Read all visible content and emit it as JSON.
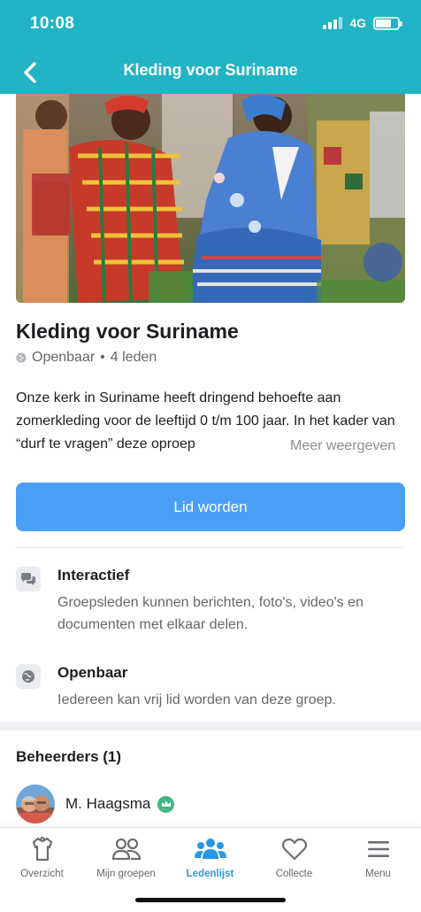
{
  "status_bar": {
    "time": "10:08",
    "network": "4G"
  },
  "nav": {
    "title": "Kleding voor Suriname",
    "back_icon": "chevron-left-icon"
  },
  "colors": {
    "header": "#22b3c4",
    "primary_button": "#4a9ff5",
    "active_tab": "#2a97e4",
    "admin_badge": "#42b883"
  },
  "group": {
    "name": "Kleding voor Suriname",
    "visibility": "Openbaar",
    "separator": "•",
    "members": "4 leden",
    "description": "Onze kerk in Suriname heeft dringend behoefte aan zomerkleding voor de leeftijd 0 t/m 100 jaar. In het kader van “durf te vragen” deze oproep",
    "more_label": "Meer weergeven",
    "join_label": "Lid worden"
  },
  "info": [
    {
      "title": "Interactief",
      "text": "Groepsleden kunnen berichten, foto's, video's en documenten met elkaar delen.",
      "icon": "chat-bubbles-icon"
    },
    {
      "title": "Openbaar",
      "text": "Iedereen kan vrij lid worden van deze groep.",
      "icon": "globe-icon"
    }
  ],
  "admins": {
    "heading": "Beheerders (1)",
    "list": [
      {
        "name": "M. Haagsma",
        "badge_icon": "crown-icon"
      }
    ]
  },
  "tabs": [
    {
      "label": "Overzicht",
      "icon": "shirt-icon",
      "active": false
    },
    {
      "label": "Mijn groepen",
      "icon": "two-people-icon",
      "active": false
    },
    {
      "label": "Ledenlijst",
      "icon": "members-icon",
      "active": true
    },
    {
      "label": "Collecte",
      "icon": "heart-icon",
      "active": false
    },
    {
      "label": "Menu",
      "icon": "hamburger-icon",
      "active": false
    }
  ]
}
